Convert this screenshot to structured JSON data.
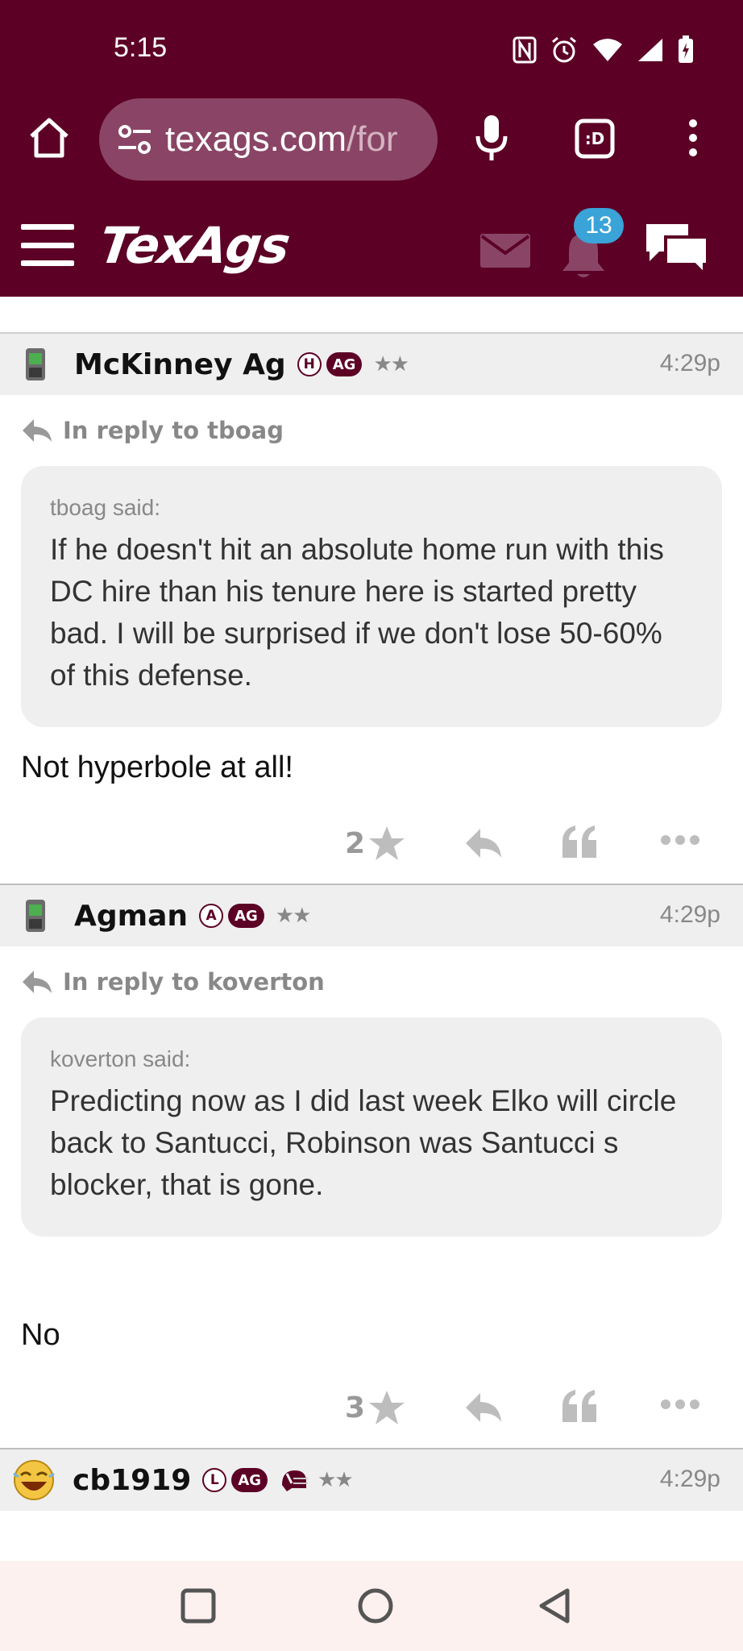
{
  "status_bar": {
    "time": "5:15",
    "icons": [
      "nfc-icon",
      "alarm-icon",
      "wifi-icon",
      "signal-icon",
      "battery-charging-icon"
    ]
  },
  "browser": {
    "url_host": "texags.com",
    "url_path": "/for",
    "icons": [
      "home-icon",
      "site-settings-icon",
      "mic-icon",
      "tab-switcher-icon",
      "overflow-menu-icon"
    ],
    "tab_label": ":D"
  },
  "site": {
    "logo": "TexAgs",
    "notification_count": "13",
    "colors": {
      "maroon": "#5c0025",
      "badge_blue": "#3aa3d8"
    }
  },
  "posts": [
    {
      "username": "McKinney Ag",
      "role_badge": "H",
      "ag_badge": "AG",
      "stars": "★★",
      "time": "4:29p",
      "reply_to": "In reply to tboag",
      "quote_author": "tboag said:",
      "quote_text": "If he doesn't hit an absolute home run with this DC hire than his tenure here is started pretty bad. I will be surprised if we don't lose 50-60% of this defense.",
      "body": "Not hyperbole at all!",
      "star_count": "2"
    },
    {
      "username": "Agman",
      "role_badge": "A",
      "ag_badge": "AG",
      "stars": "★★",
      "time": "4:29p",
      "reply_to": "In reply to koverton",
      "quote_author": "koverton said:",
      "quote_text": "Predicting now as I did last week Elko will circle back to Santucci, Robinson was Santucci s blocker, that is gone.",
      "body": "No",
      "star_count": "3"
    },
    {
      "username": "cb1919",
      "role_badge": "L",
      "ag_badge": "AG",
      "stars": "★★",
      "time": "4:29p"
    }
  ]
}
